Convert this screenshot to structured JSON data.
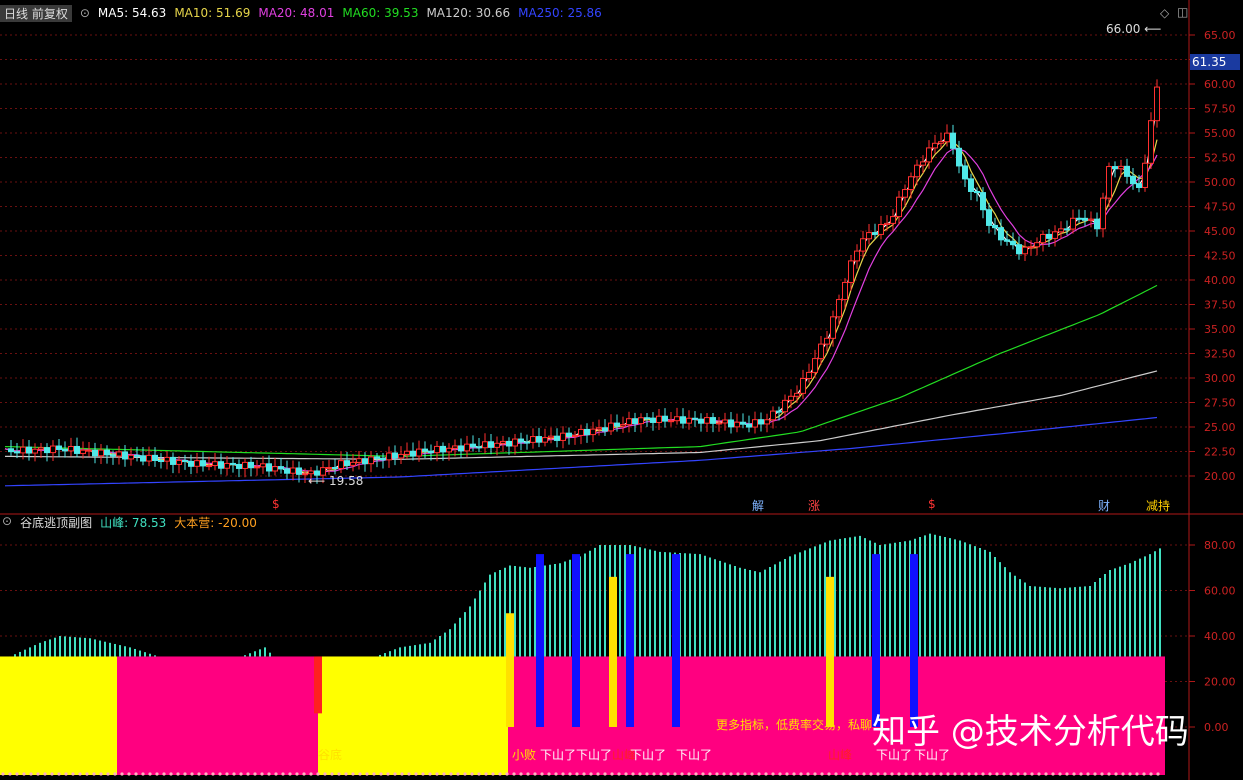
{
  "main_header": {
    "period_label": "日线 前复权",
    "indicators": [
      {
        "label": "MA5: 54.63",
        "color": "#ffffff"
      },
      {
        "label": "MA10: 51.69",
        "color": "#e6d54a"
      },
      {
        "label": "MA20: 48.01",
        "color": "#e040e0"
      },
      {
        "label": "MA60: 39.53",
        "color": "#22dd22"
      },
      {
        "label": "MA120: 30.66",
        "color": "#cccccc"
      },
      {
        "label": "MA250: 25.86",
        "color": "#3344ff"
      }
    ]
  },
  "price_axis": {
    "ticks": [
      "65.00",
      "62.50",
      "60.00",
      "57.50",
      "55.00",
      "52.50",
      "50.00",
      "47.50",
      "45.00",
      "42.50",
      "40.00",
      "37.50",
      "35.00",
      "32.50",
      "30.00",
      "27.50",
      "25.00",
      "22.50",
      "20.00"
    ],
    "current_price": "61.35",
    "max_label": "66.00",
    "min_label": "19.58"
  },
  "event_markers": [
    {
      "label": "$",
      "color": "#ff3333"
    },
    {
      "label": "解",
      "color": "#7fb3ff"
    },
    {
      "label": "涨",
      "color": "#ff4444"
    },
    {
      "label": "$",
      "color": "#ff3333"
    },
    {
      "label": "财",
      "color": "#7fb3ff"
    },
    {
      "label": "减持",
      "color": "#ffd000"
    }
  ],
  "sub_header": {
    "title": "谷底逃顶副图",
    "mountain_label": "山峰: 78.53",
    "camp_label": "大本营: -20.00"
  },
  "sub_axis": {
    "ticks": [
      "80.00",
      "60.00",
      "40.00",
      "20.00",
      "0.00"
    ]
  },
  "signals": {
    "bottom": "谷底",
    "small_loss": "小败",
    "down": "下山了",
    "mountain": "山峰",
    "ad_text": "更多指标，低费率交易，私聊"
  },
  "watermark": "知乎 @技术分析代码",
  "chart_data": [
    {
      "type": "candlestick",
      "title": "",
      "ylim": [
        19.0,
        66.5
      ],
      "series": [
        {
          "name": "MA5",
          "color": "#ffffff"
        },
        {
          "name": "MA10",
          "color": "#e6d54a"
        },
        {
          "name": "MA20",
          "color": "#e040e0"
        },
        {
          "name": "MA60",
          "color": "#22dd22"
        },
        {
          "name": "MA120",
          "color": "#cccccc"
        },
        {
          "name": "MA250",
          "color": "#3344ff"
        }
      ],
      "annotations": [
        {
          "label": "66.00",
          "y": 66.0
        },
        {
          "label": "19.58",
          "y": 19.58
        }
      ]
    },
    {
      "type": "bar",
      "title": "谷底逃顶副图",
      "ylim": [
        0,
        90
      ],
      "series": [
        {
          "name": "山峰",
          "last_value": 78.53,
          "color": "#40e0c0"
        },
        {
          "name": "大本营",
          "last_value": -20.0
        }
      ]
    }
  ]
}
